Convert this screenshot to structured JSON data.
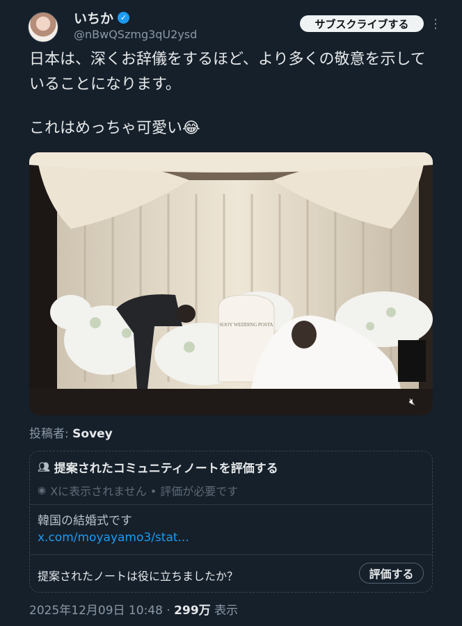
{
  "author": {
    "name": "いちか",
    "handle": "@nBwQSzmg3qU2ysd",
    "verified_icon": "verified-badge-icon"
  },
  "header": {
    "subscribe_label": "サブスクライブする",
    "more_icon": "more-vertical-icon"
  },
  "tweet": {
    "text_p1": "日本は、深くお辞儀をするほど、より多くの敬意を示していることになります。",
    "text_p2": "これはめっちゃ可愛い😂"
  },
  "media": {
    "stage_sign": "SOOY WEDDING POSTA",
    "mute_icon": "volume-muted-icon"
  },
  "attribution": {
    "prefix": "投稿者:",
    "name": "Sovey"
  },
  "community_note": {
    "title": "提案されたコミュニティノートを評価する",
    "status": "Xに表示されません • 評価が必要です",
    "body": "韓国の結婚式です",
    "link": "x.com/moyayamo3/stat...",
    "question": "提案されたノートは役に立ちましたか？",
    "rate_label": "評価する"
  },
  "meta": {
    "timestamp": "2025年12月09日 10:48",
    "separator": "·",
    "views": "299万",
    "views_label": "表示"
  },
  "colors": {
    "background": "#15202b",
    "accent": "#1d9bf0",
    "text": "#e7e9ea",
    "muted": "#8b98a5"
  }
}
